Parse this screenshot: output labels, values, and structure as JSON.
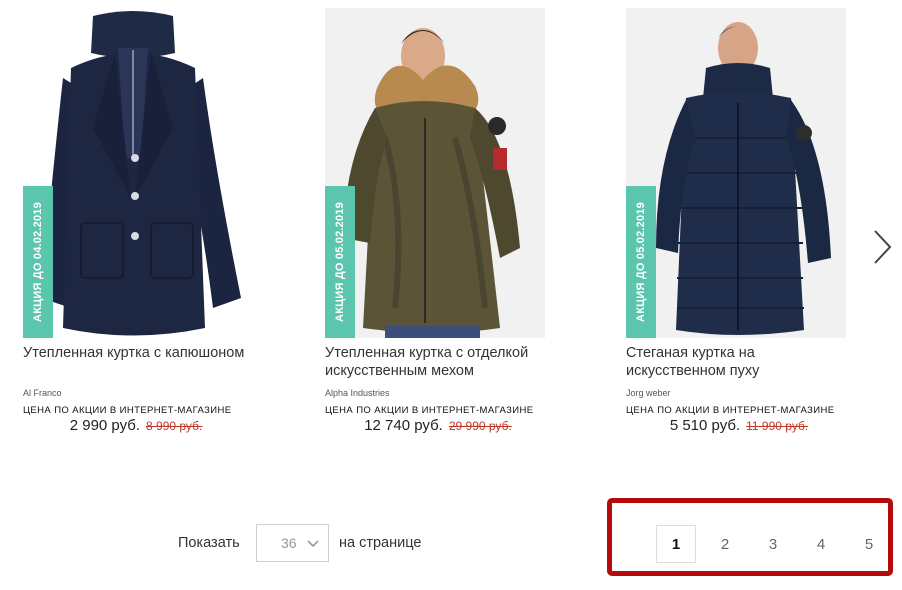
{
  "products": [
    {
      "promo_badge": "АКЦИЯ ДО 04.02.2019",
      "title": "Утепленная куртка с капюшоном",
      "brand": "Al Franco",
      "promo_label": "ЦЕНА ПО АКЦИИ В ИНТЕРНЕТ-МАГАЗИНЕ",
      "price": "2 990 руб.",
      "old_price": "8 990 руб."
    },
    {
      "promo_badge": "АКЦИЯ ДО 05.02.2019",
      "title": "Утепленная куртка с отделкой искусственным мехом",
      "brand": "Alpha Industries",
      "promo_label": "ЦЕНА ПО АКЦИИ В ИНТЕРНЕТ-МАГАЗИНЕ",
      "price": "12 740 руб.",
      "old_price": "29 990 руб."
    },
    {
      "promo_badge": "АКЦИЯ ДО 05.02.2019",
      "title": "Стеганая куртка на искусственном пуху",
      "brand": "Jorg weber",
      "promo_label": "ЦЕНА ПО АКЦИИ В ИНТЕРНЕТ-МАГАЗИНЕ",
      "price": "5 510 руб.",
      "old_price": "11 990 руб."
    }
  ],
  "next_arrow_icon": "chevron-right-icon",
  "per_page": {
    "prefix": "Показать",
    "value": "36",
    "suffix": "на странице",
    "icon": "chevron-down-icon"
  },
  "pagination": {
    "pages": [
      "1",
      "2",
      "3",
      "4",
      "5"
    ],
    "current": "1"
  },
  "colors": {
    "badge": "#5cc5ae",
    "old_price": "#c0392b",
    "highlight": "#b40c0c"
  }
}
